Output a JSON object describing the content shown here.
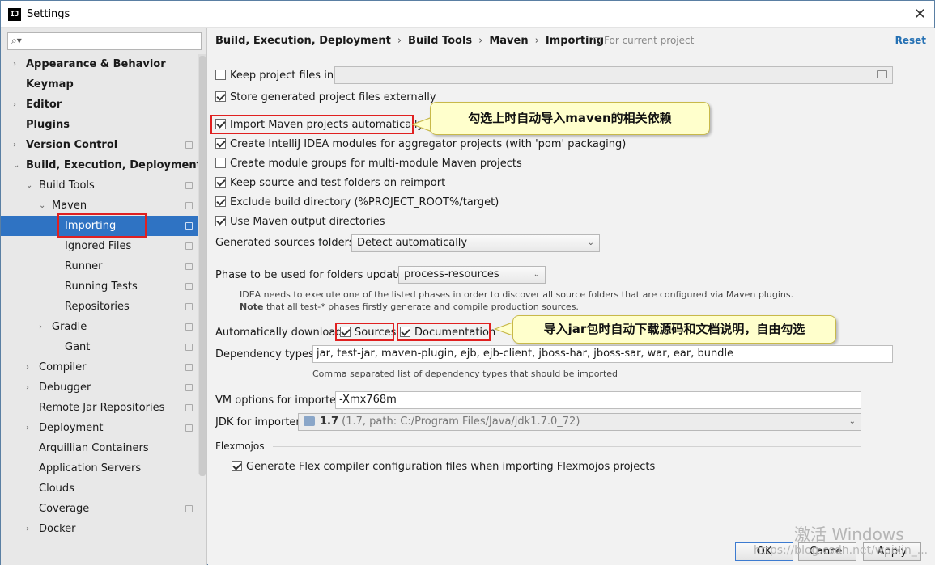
{
  "window": {
    "title": "Settings",
    "app_icon_text": "IJ",
    "close_glyph": "✕"
  },
  "search": {
    "placeholder": "",
    "icon": "search-icon"
  },
  "sidebar": {
    "items": [
      {
        "label": "Appearance & Behavior",
        "bold": true,
        "arrow": "›"
      },
      {
        "label": "Keymap",
        "bold": true
      },
      {
        "label": "Editor",
        "bold": true,
        "arrow": "›"
      },
      {
        "label": "Plugins",
        "bold": true
      },
      {
        "label": "Version Control",
        "bold": true,
        "arrow": "›"
      },
      {
        "label": "Build, Execution, Deployment",
        "bold": true,
        "arrow": "⌄"
      },
      {
        "label": "Build Tools",
        "arrow": "⌄"
      },
      {
        "label": "Maven",
        "arrow": "⌄"
      },
      {
        "label": "Importing",
        "selected": true
      },
      {
        "label": "Ignored Files"
      },
      {
        "label": "Runner"
      },
      {
        "label": "Running Tests"
      },
      {
        "label": "Repositories"
      },
      {
        "label": "Gradle",
        "arrow": "›"
      },
      {
        "label": "Gant"
      },
      {
        "label": "Compiler",
        "arrow": "›"
      },
      {
        "label": "Debugger",
        "arrow": "›"
      },
      {
        "label": "Remote Jar Repositories"
      },
      {
        "label": "Deployment",
        "arrow": "›"
      },
      {
        "label": "Arquillian Containers"
      },
      {
        "label": "Application Servers"
      },
      {
        "label": "Clouds"
      },
      {
        "label": "Coverage"
      },
      {
        "label": "Docker",
        "arrow": "›"
      }
    ]
  },
  "breadcrumb": {
    "parts": [
      "Build, Execution, Deployment",
      "Build Tools",
      "Maven",
      "Importing"
    ],
    "separator": "›"
  },
  "for_project": "For current project",
  "reset_label": "Reset",
  "options": {
    "keep_project_files": {
      "label": "Keep project files in:",
      "checked": false
    },
    "store_externally": {
      "label": "Store generated project files externally",
      "checked": true
    },
    "import_auto": {
      "label": "Import Maven projects automatically",
      "checked": true
    },
    "create_modules": {
      "label": "Create IntelliJ IDEA modules for aggregator projects (with 'pom' packaging)",
      "checked": true
    },
    "module_groups": {
      "label": "Create module groups for multi-module Maven projects",
      "checked": false
    },
    "keep_source": {
      "label": "Keep source and test folders on reimport",
      "checked": true
    },
    "exclude_build": {
      "label": "Exclude build directory (%PROJECT_ROOT%/target)",
      "checked": true
    },
    "use_output": {
      "label": "Use Maven output directories",
      "checked": true
    }
  },
  "generated_sources": {
    "label": "Generated sources folders:",
    "value": "Detect automatically"
  },
  "phase": {
    "label": "Phase to be used for folders update:",
    "value": "process-resources",
    "note1": "IDEA needs to execute one of the listed phases in order to discover all source folders that are configured via Maven plugins.",
    "note2_bold": "Note",
    "note2": " that all test-* phases firstly generate and compile production sources."
  },
  "auto_download": {
    "label": "Automatically download:",
    "sources": {
      "label": "Sources",
      "checked": true
    },
    "documentation": {
      "label": "Documentation",
      "checked": true
    }
  },
  "dependency_types": {
    "label": "Dependency types:",
    "value": "jar, test-jar, maven-plugin, ejb, ejb-client, jboss-har, jboss-sar, war, ear, bundle",
    "note": "Comma separated list of dependency types that should be imported"
  },
  "vm_options": {
    "label": "VM options for importer:",
    "value": "-Xmx768m"
  },
  "jdk": {
    "label": "JDK for importer:",
    "value_bold": "1.7",
    "value": " (1.7, path: C:/Program Files/Java/jdk1.7.0_72)"
  },
  "flexmojos": {
    "section": "Flexmojos",
    "generate": {
      "label": "Generate Flex compiler configuration files when importing Flexmojos projects",
      "checked": true
    }
  },
  "callouts": {
    "import": "勾选上时自动导入maven的相关依赖",
    "download": "导入jar包时自动下载源码和文档说明，自由勾选"
  },
  "buttons": {
    "ok": "OK",
    "cancel": "Cancel",
    "apply": "Apply"
  },
  "watermark": {
    "line1": "激活 Windows",
    "line2": "https://blog.csdn.net/weixin_..."
  },
  "colors": {
    "selection": "#2f73c3",
    "highlight_box": "#e02020",
    "callout_bg": "#ffffcc",
    "link": "#2470b3"
  }
}
